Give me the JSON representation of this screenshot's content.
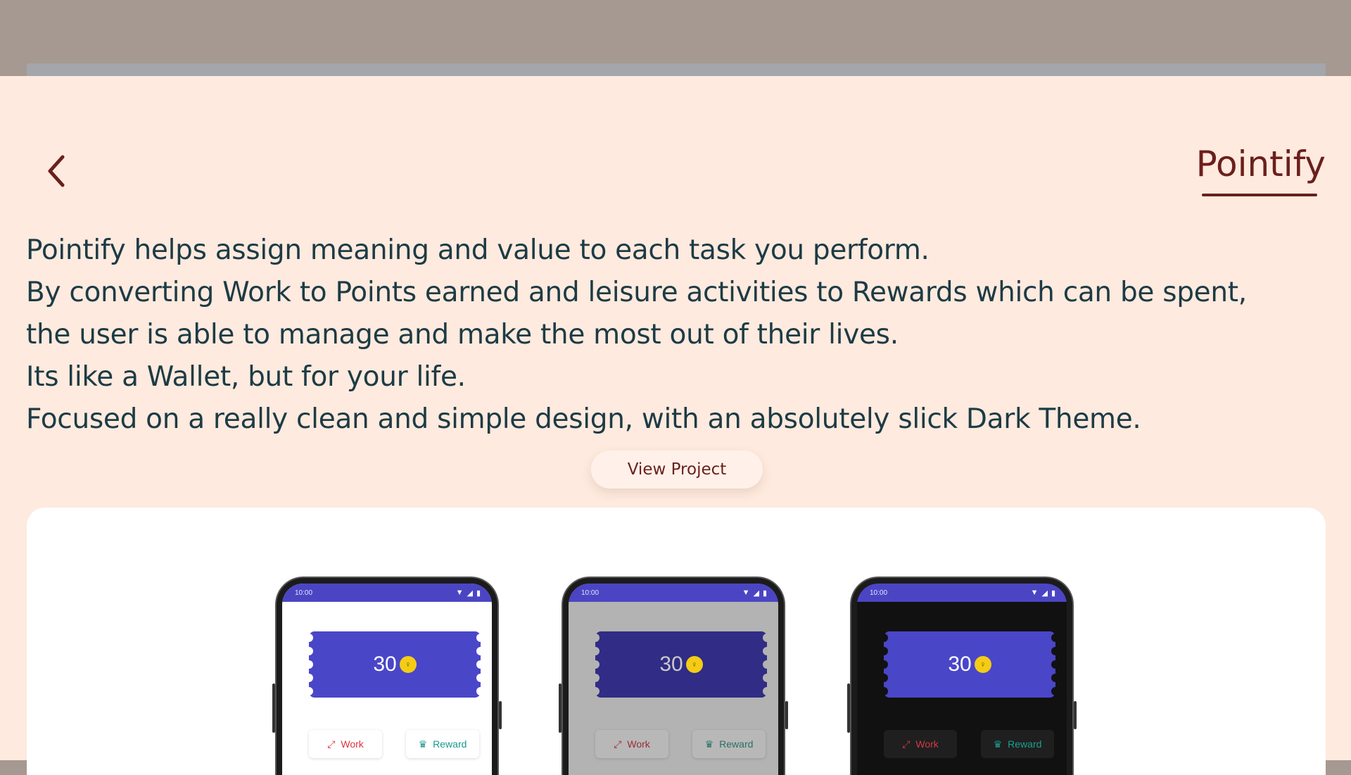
{
  "page": {
    "title": "Pointify",
    "view_button": "View Project",
    "description": [
      "Pointify helps assign meaning and value to each task you perform.",
      "By converting Work to Points earned and leisure activities to Rewards which can be spent,",
      "the user is able to manage and make the most out of their lives.",
      "Its like a Wallet, but for your life.",
      "Focused on a really clean and simple design, with an absolutely slick Dark Theme."
    ]
  },
  "phones": [
    {
      "theme": "light",
      "time": "10:00",
      "points": "30",
      "work_label": "Work",
      "reward_label": "Reward"
    },
    {
      "theme": "grey",
      "time": "10:00",
      "points": "30",
      "work_label": "Work",
      "reward_label": "Reward"
    },
    {
      "theme": "dark",
      "time": "10:00",
      "points": "30",
      "work_label": "Work",
      "reward_label": "Reward"
    }
  ],
  "icons": {
    "back": "chevron-left-icon",
    "wifi": "wifi-icon",
    "signal": "signal-icon",
    "battery": "battery-icon",
    "coin": "coin-icon",
    "work": "dumbbell-icon",
    "reward": "trophy-icon"
  },
  "colors": {
    "background": "#feeade",
    "accent": "#6b1f1c",
    "text": "#1d3b45",
    "app_primary": "#4a46c8",
    "coin": "#f5cc15",
    "work": "#d9343f",
    "reward": "#17998a"
  }
}
